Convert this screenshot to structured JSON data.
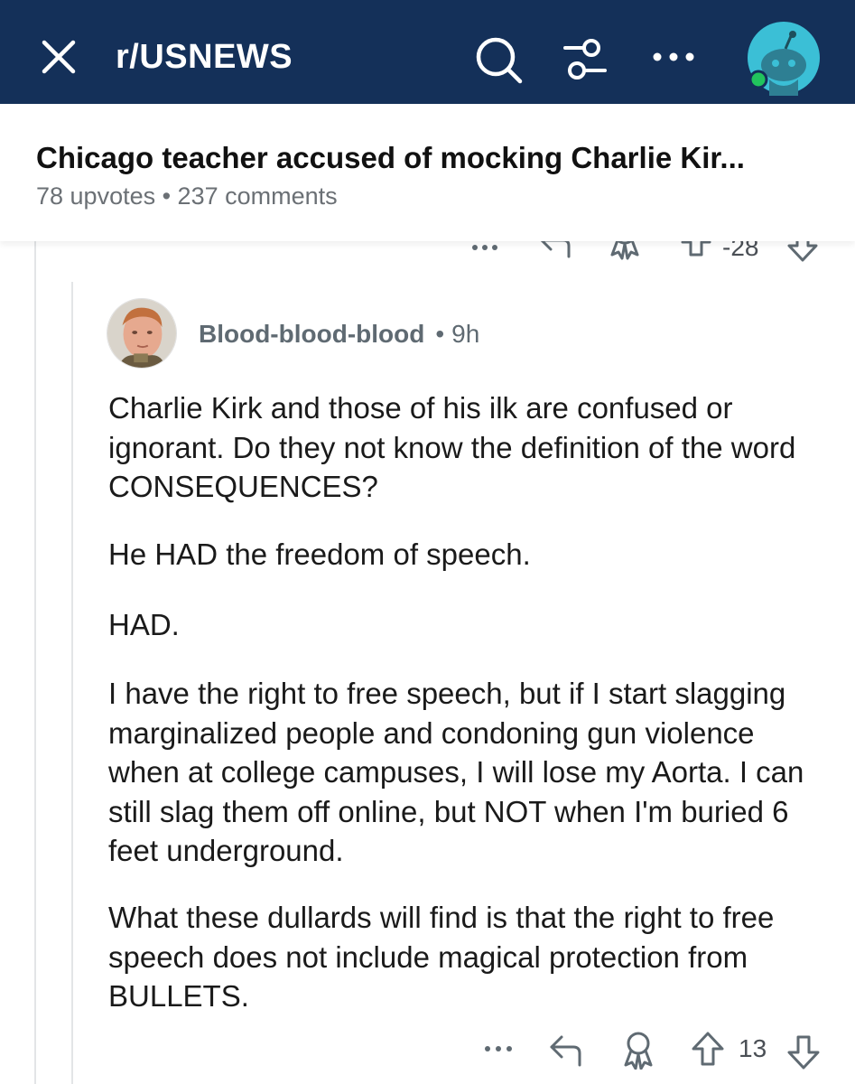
{
  "header": {
    "subreddit": "r/USNEWS"
  },
  "post": {
    "title": "Chicago teacher accused of mocking Charlie Kir...",
    "meta": "78 upvotes • 237 comments"
  },
  "previous_comment": {
    "vote_count": "-28"
  },
  "comment": {
    "author": "Blood-blood-blood",
    "separator": "•",
    "age": "9h",
    "paragraphs": [
      "Charlie Kirk and those of his ilk are confused or ignorant. Do they not know the definition of the word CONSEQUENCES?",
      "He HAD the freedom of speech.",
      "HAD.",
      "I have the right to free speech, but if I start slagging marginalized people and condoning gun violence when at college campuses, I will lose my Aorta. I can still slag them off online, but NOT when I'm buried 6 feet underground.",
      "What these dullards will find is that the right to free speech does not include magical protection from BULLETS."
    ],
    "vote_count": "13"
  },
  "colors": {
    "nav_bg": "#143059",
    "avatar_bg": "#3bbfd6",
    "online_dot": "#21c45d",
    "meta_text": "#6b7075",
    "icon_gray": "#5f6a72"
  },
  "icons": {
    "close": "close-icon",
    "search": "search-icon",
    "filter": "filter-icon",
    "more": "more-icon",
    "reply": "reply-icon",
    "award": "award-icon",
    "upvote": "upvote-icon",
    "downvote": "downvote-icon"
  }
}
